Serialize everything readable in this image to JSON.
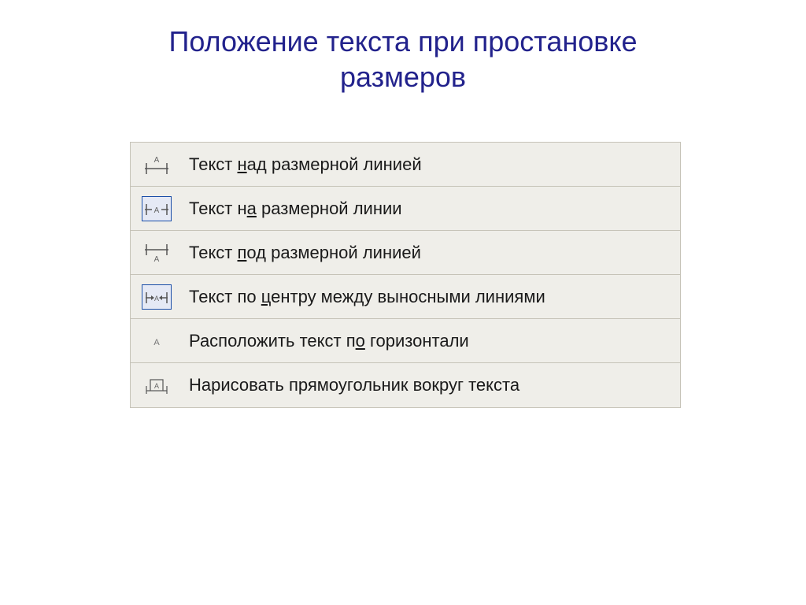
{
  "title_line1": "Положение текста при простановке",
  "title_line2": "размеров",
  "menu": {
    "items": [
      {
        "label_html": "Текст <u>н</u>ад размерной линией",
        "icon": "text-above-line",
        "selected": false
      },
      {
        "label_html": "Текст н<u>а</u> размерной линии",
        "icon": "text-on-line",
        "selected": true
      },
      {
        "label_html": "Текст <u>п</u>од размерной линией",
        "icon": "text-below-line",
        "selected": false
      },
      {
        "label_html": "Текст по <u>ц</u>ентру между выносными линиями",
        "icon": "text-center-between",
        "selected": true
      },
      {
        "label_html": "Расположить текст п<u>о</u> горизонтали",
        "icon": "text-horizontal",
        "selected": false
      },
      {
        "label_html": "Нарисовать прямоугольник вокруг текста",
        "icon": "text-rectangle",
        "selected": false
      }
    ]
  }
}
